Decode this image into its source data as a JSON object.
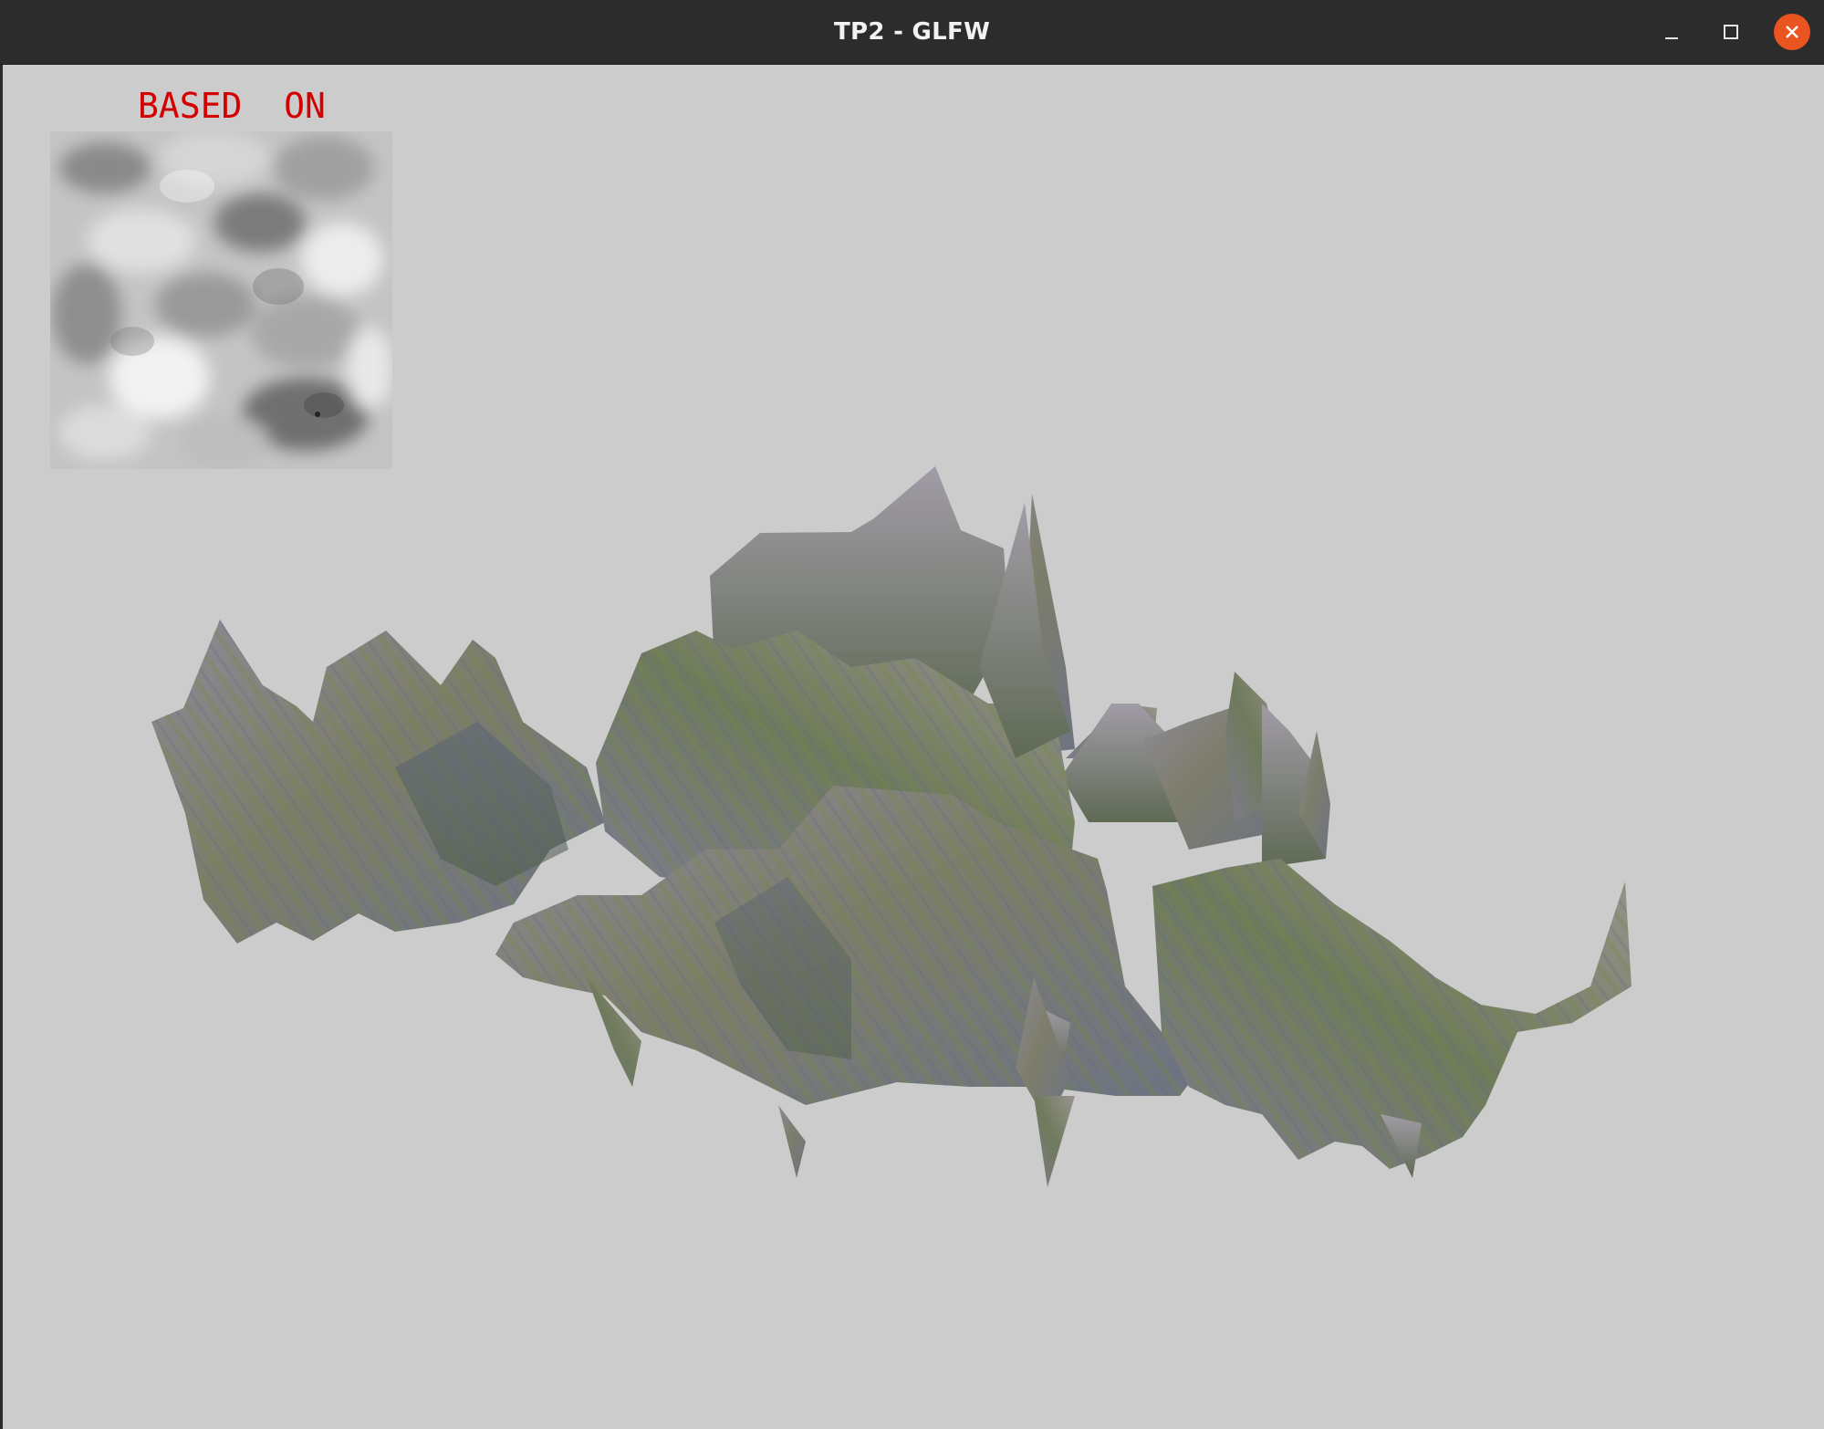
{
  "window": {
    "title": "TP2 - GLFW",
    "controls": [
      "minimize-icon",
      "maximize-icon",
      "close-icon"
    ],
    "close_color": "#e95420"
  },
  "viewport": {
    "background": "#cccccc",
    "overlay_text": "BASED  ON",
    "overlay_color": "#d40000"
  }
}
